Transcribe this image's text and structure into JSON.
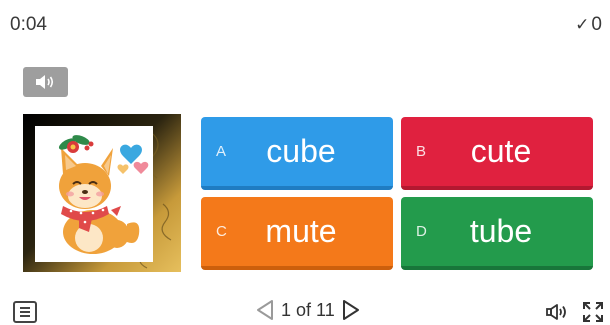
{
  "header": {
    "timer": "0:04",
    "score_icon": "check-icon",
    "score": "0"
  },
  "question": {
    "audio_icon": "speaker-icon",
    "image": "shiba-dog-illustration"
  },
  "answers": [
    {
      "letter": "A",
      "word": "cube",
      "color": "#2f9be8"
    },
    {
      "letter": "B",
      "word": "cute",
      "color": "#e0213f"
    },
    {
      "letter": "C",
      "word": "mute",
      "color": "#f4791a"
    },
    {
      "letter": "D",
      "word": "tube",
      "color": "#239b4c"
    }
  ],
  "footer": {
    "menu_icon": "menu-icon",
    "page_text": "1 of 11",
    "prev_icon": "triangle-left-icon",
    "next_icon": "triangle-right-icon",
    "sound_icon": "sound-icon",
    "fullscreen_icon": "fullscreen-icon"
  }
}
